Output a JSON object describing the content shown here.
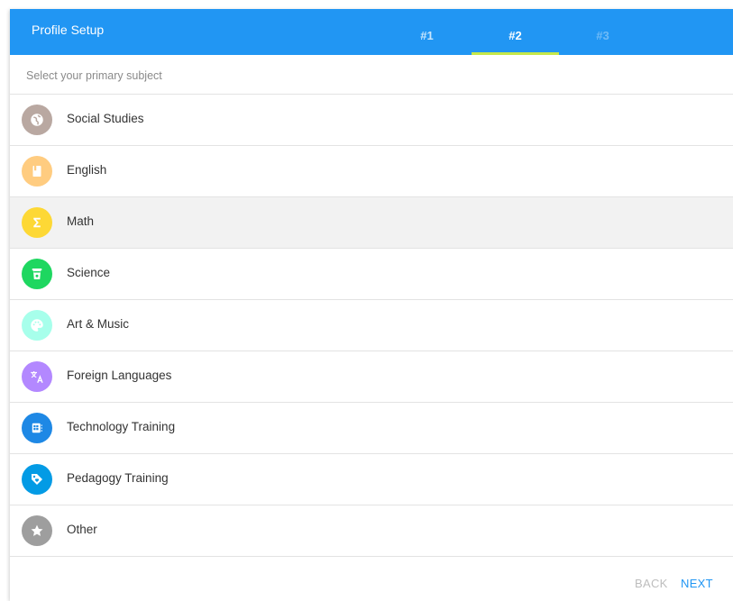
{
  "header": {
    "title": "Profile Setup",
    "tabs": [
      {
        "label": "#1",
        "state": "visited"
      },
      {
        "label": "#2",
        "state": "active"
      },
      {
        "label": "#3",
        "state": "disabled"
      }
    ],
    "color": "#2196f3",
    "indicator_color": "#c6e84a"
  },
  "prompt": "Select your primary subject",
  "subjects": [
    {
      "label": "Social Studies",
      "icon": "globe-icon",
      "color": "#b9a8a1"
    },
    {
      "label": "English",
      "icon": "book-icon",
      "color": "#ffcc80"
    },
    {
      "label": "Math",
      "icon": "sigma-icon",
      "color": "#fdd835",
      "selected": true
    },
    {
      "label": "Science",
      "icon": "beaker-icon",
      "color": "#1ed760"
    },
    {
      "label": "Art & Music",
      "icon": "palette-icon",
      "color": "#a7ffeb"
    },
    {
      "label": "Foreign Languages",
      "icon": "translate-icon",
      "color": "#b388ff"
    },
    {
      "label": "Technology Training",
      "icon": "chip-icon",
      "color": "#1e88e5"
    },
    {
      "label": "Pedagogy Training",
      "icon": "tag-icon",
      "color": "#039be5"
    },
    {
      "label": "Other",
      "icon": "star-icon",
      "color": "#9e9e9e"
    }
  ],
  "footer": {
    "back_label": "BACK",
    "next_label": "NEXT"
  }
}
